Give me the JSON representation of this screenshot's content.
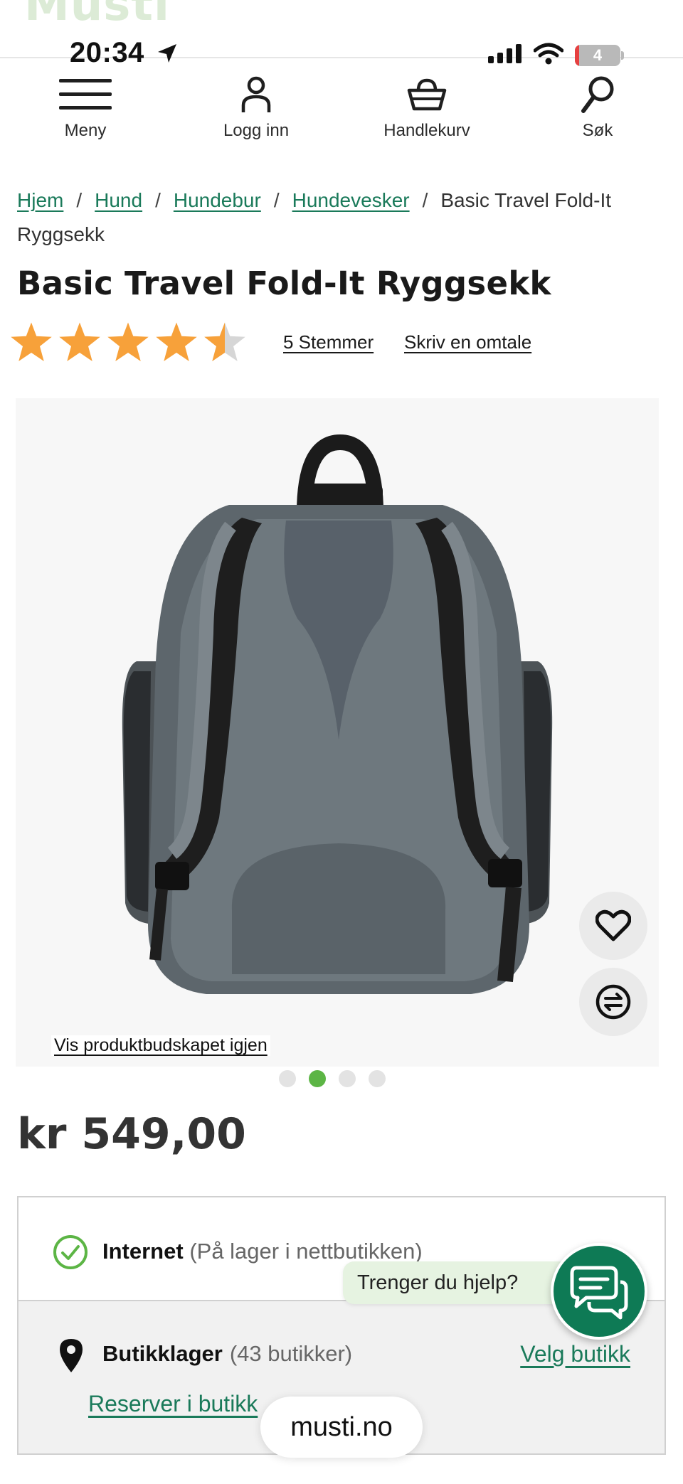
{
  "status_bar": {
    "time": "20:34",
    "battery": "4"
  },
  "background_logo": "Musti",
  "nav": {
    "menu": "Meny",
    "login": "Logg inn",
    "cart": "Handlekurv",
    "search": "Søk"
  },
  "breadcrumb": {
    "items": [
      "Hjem",
      "Hund",
      "Hundebur",
      "Hundevesker"
    ],
    "separator": "/",
    "current": "Basic Travel Fold-It Ryggsekk"
  },
  "product": {
    "title": "Basic Travel Fold-It Ryggsekk",
    "rating_value": 4.5,
    "rating_max": 5,
    "votes_link": "5 Stemmer",
    "write_review": "Skriv en omtale",
    "show_message": "Vis produktbudskapet igjen",
    "gallery_count": 4,
    "gallery_active": 1,
    "price": "kr 549,00"
  },
  "stock": {
    "internet_label": "Internet",
    "internet_note": "(På lager i nettbutikken)",
    "store_label": "Butikklager",
    "store_count": "(43 butikker)",
    "choose_store": "Velg butikk",
    "reserve": "Reserver i butikk"
  },
  "chat": {
    "bubble": "Trenger du hjelp?"
  },
  "browser": {
    "url": "musti.no"
  },
  "colors": {
    "brand_green": "#1a7a5a",
    "star": "#f7a13a",
    "dot_active": "#5cb545",
    "chat": "#0e7a55"
  }
}
